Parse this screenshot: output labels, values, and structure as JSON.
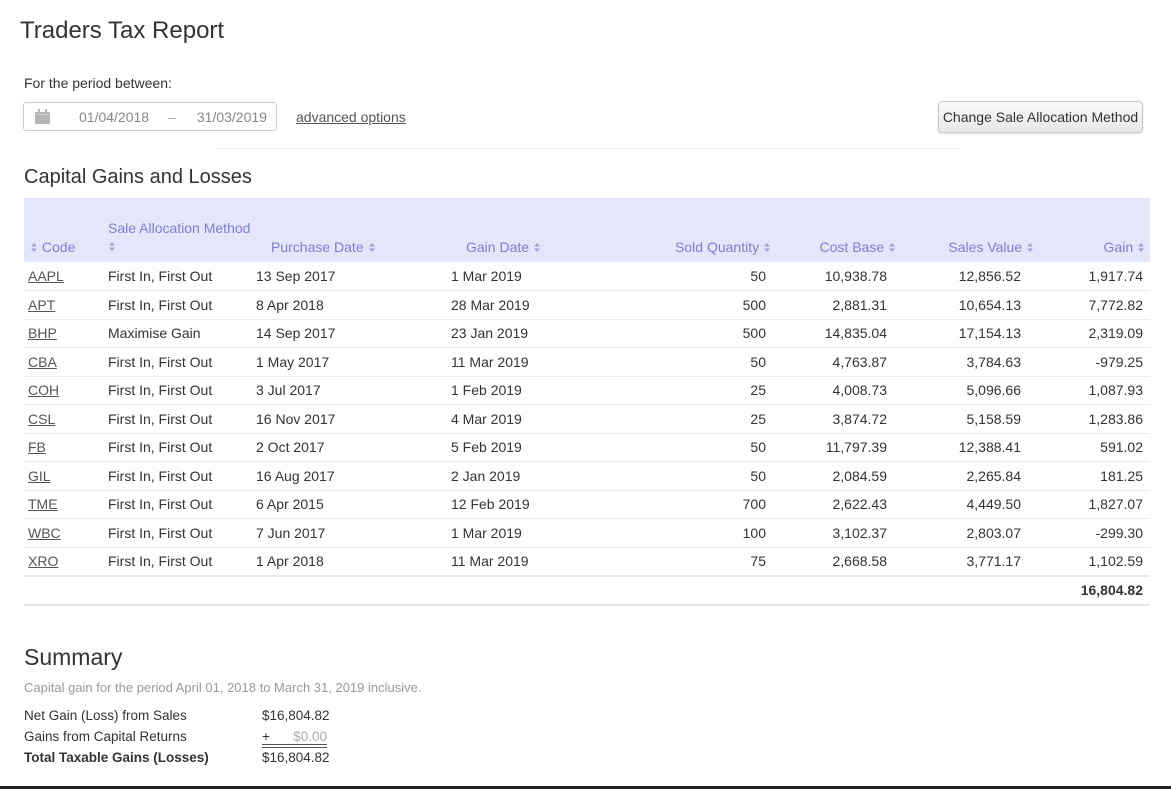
{
  "page": {
    "title": "Traders Tax Report"
  },
  "period": {
    "label": "For the period between:",
    "start": "01/04/2018",
    "separator": "–",
    "end": "31/03/2019",
    "calendar_icon": "calendar-icon",
    "advanced_link": "advanced options"
  },
  "actions": {
    "change_method_button": "Change Sale Allocation Method"
  },
  "capital_gains": {
    "title": "Capital Gains and Losses",
    "sort_icon": "sort-updown-icon",
    "columns": {
      "code": "Code",
      "method": "Sale Allocation Method",
      "purchase_date": "Purchase Date",
      "gain_date": "Gain Date",
      "sold_quantity": "Sold Quantity",
      "cost_base": "Cost Base",
      "sales_value": "Sales Value",
      "gain": "Gain"
    },
    "rows": [
      {
        "code": "AAPL",
        "method": "First In, First Out",
        "purchase_date": "13 Sep 2017",
        "gain_date": "1 Mar 2019",
        "sold_quantity": "50",
        "cost_base": "10,938.78",
        "sales_value": "12,856.52",
        "gain": "1,917.74",
        "negative": false
      },
      {
        "code": "APT",
        "method": "First In, First Out",
        "purchase_date": "8 Apr 2018",
        "gain_date": "28 Mar 2019",
        "sold_quantity": "500",
        "cost_base": "2,881.31",
        "sales_value": "10,654.13",
        "gain": "7,772.82",
        "negative": false
      },
      {
        "code": "BHP",
        "method": "Maximise Gain",
        "purchase_date": "14 Sep 2017",
        "gain_date": "23 Jan 2019",
        "sold_quantity": "500",
        "cost_base": "14,835.04",
        "sales_value": "17,154.13",
        "gain": "2,319.09",
        "negative": false
      },
      {
        "code": "CBA",
        "method": "First In, First Out",
        "purchase_date": "1 May 2017",
        "gain_date": "11 Mar 2019",
        "sold_quantity": "50",
        "cost_base": "4,763.87",
        "sales_value": "3,784.63",
        "gain": "-979.25",
        "negative": true
      },
      {
        "code": "COH",
        "method": "First In, First Out",
        "purchase_date": "3 Jul 2017",
        "gain_date": "1 Feb 2019",
        "sold_quantity": "25",
        "cost_base": "4,008.73",
        "sales_value": "5,096.66",
        "gain": "1,087.93",
        "negative": false
      },
      {
        "code": "CSL",
        "method": "First In, First Out",
        "purchase_date": "16 Nov 2017",
        "gain_date": "4 Mar 2019",
        "sold_quantity": "25",
        "cost_base": "3,874.72",
        "sales_value": "5,158.59",
        "gain": "1,283.86",
        "negative": false
      },
      {
        "code": "FB",
        "method": "First In, First Out",
        "purchase_date": "2 Oct 2017",
        "gain_date": "5 Feb 2019",
        "sold_quantity": "50",
        "cost_base": "11,797.39",
        "sales_value": "12,388.41",
        "gain": "591.02",
        "negative": false
      },
      {
        "code": "GIL",
        "method": "First In, First Out",
        "purchase_date": "16 Aug 2017",
        "gain_date": "2 Jan 2019",
        "sold_quantity": "50",
        "cost_base": "2,084.59",
        "sales_value": "2,265.84",
        "gain": "181.25",
        "negative": false
      },
      {
        "code": "TME",
        "method": "First In, First Out",
        "purchase_date": "6 Apr 2015",
        "gain_date": "12 Feb 2019",
        "sold_quantity": "700",
        "cost_base": "2,622.43",
        "sales_value": "4,449.50",
        "gain": "1,827.07",
        "negative": false
      },
      {
        "code": "WBC",
        "method": "First In, First Out",
        "purchase_date": "7 Jun 2017",
        "gain_date": "1 Mar 2019",
        "sold_quantity": "100",
        "cost_base": "3,102.37",
        "sales_value": "2,803.07",
        "gain": "-299.30",
        "negative": true
      },
      {
        "code": "XRO",
        "method": "First In, First Out",
        "purchase_date": "1 Apr 2018",
        "gain_date": "11 Mar 2019",
        "sold_quantity": "75",
        "cost_base": "2,668.58",
        "sales_value": "3,771.17",
        "gain": "1,102.59",
        "negative": false
      }
    ],
    "total_gain": "16,804.82"
  },
  "summary": {
    "title": "Summary",
    "subtitle": "Capital gain for the period April 01, 2018 to March 31, 2019 inclusive.",
    "net_gain_label": "Net Gain (Loss) from Sales",
    "net_gain_value": "$16,804.82",
    "capital_returns_label": "Gains from Capital Returns",
    "capital_returns_prefix": "+",
    "capital_returns_value": "$0.00",
    "total_label": "Total Taxable Gains (Losses)",
    "total_value": "$16,804.82"
  },
  "colors": {
    "header_bg": "#e5e6fa",
    "header_text": "#7b7fd3",
    "negative_text": "#999999"
  }
}
